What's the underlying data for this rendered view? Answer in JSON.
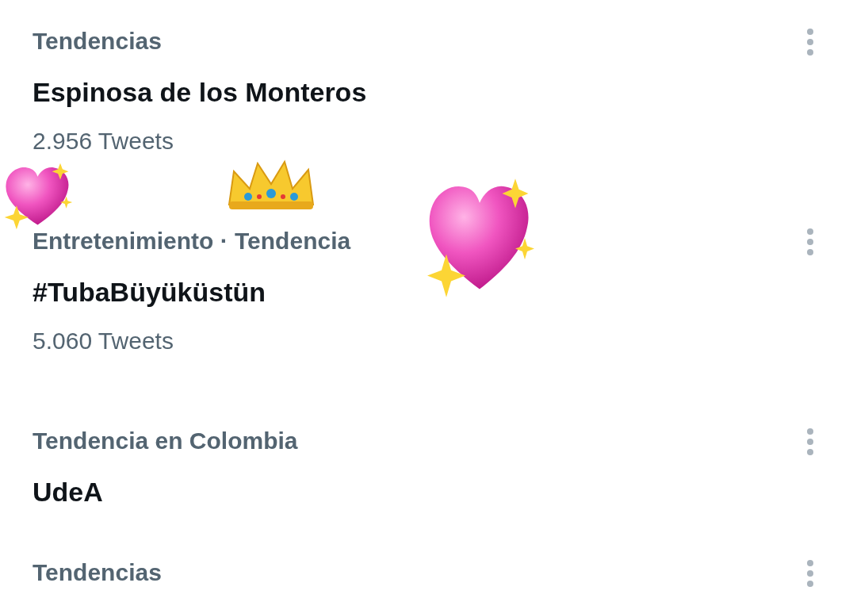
{
  "trends": [
    {
      "context": "Tendencias",
      "title": "Espinosa de los Monteros",
      "count": "2.956 Tweets"
    },
    {
      "context": "Entretenimiento · Tendencia",
      "title": "#TubaBüyüküstün",
      "count": "5.060 Tweets"
    },
    {
      "context": "Tendencia en Colombia",
      "title": "UdeA"
    },
    {
      "context": "Tendencias"
    }
  ]
}
